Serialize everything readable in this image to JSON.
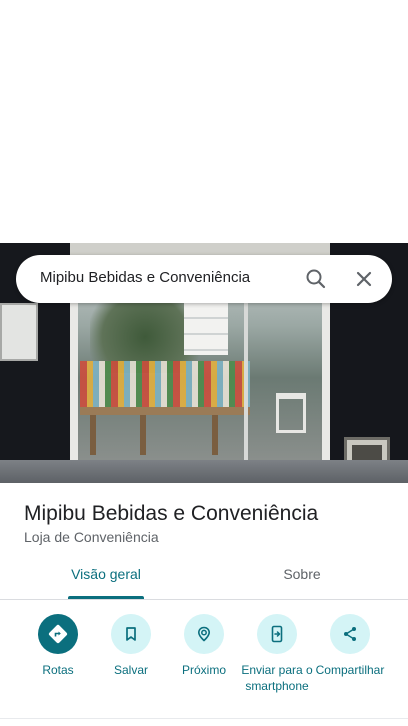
{
  "search": {
    "query": "Mipibu Bebidas e Conveniência",
    "search_icon": "search-icon",
    "close_icon": "close-icon"
  },
  "place": {
    "name": "Mipibu Bebidas e Conveniência",
    "category": "Loja de Conveniência"
  },
  "tabs": [
    {
      "label": "Visão geral",
      "selected": true
    },
    {
      "label": "Sobre",
      "selected": false
    }
  ],
  "actions": [
    {
      "label": "Rotas",
      "icon": "directions-icon"
    },
    {
      "label": "Salvar",
      "icon": "bookmark-icon"
    },
    {
      "label": "Próximo",
      "icon": "nearby-icon"
    },
    {
      "label": "Enviar para o smartphone",
      "icon": "send-to-phone-icon"
    },
    {
      "label": "Compartilhar",
      "icon": "share-icon"
    }
  ],
  "colors": {
    "accent": "#0b6f7e",
    "action_bg": "#d4f4f6",
    "text_secondary": "#5f6368"
  }
}
